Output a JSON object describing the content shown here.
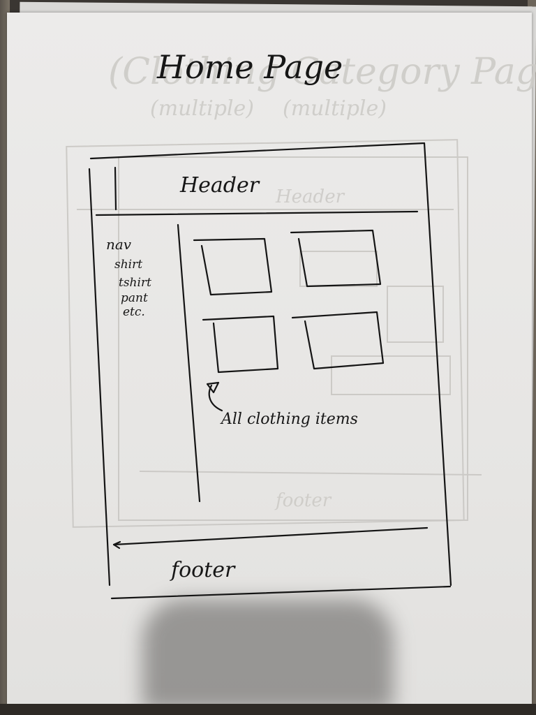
{
  "page": {
    "title": "Home Page",
    "header_label": "Header",
    "sidebar_items": [
      "nav",
      "shirt",
      "tshirt",
      "pant",
      "etc."
    ],
    "content_annotation": "All clothing items",
    "footer_label": "footer"
  },
  "colors": {
    "ink": "#141414",
    "paper": "#e9e8e6"
  }
}
